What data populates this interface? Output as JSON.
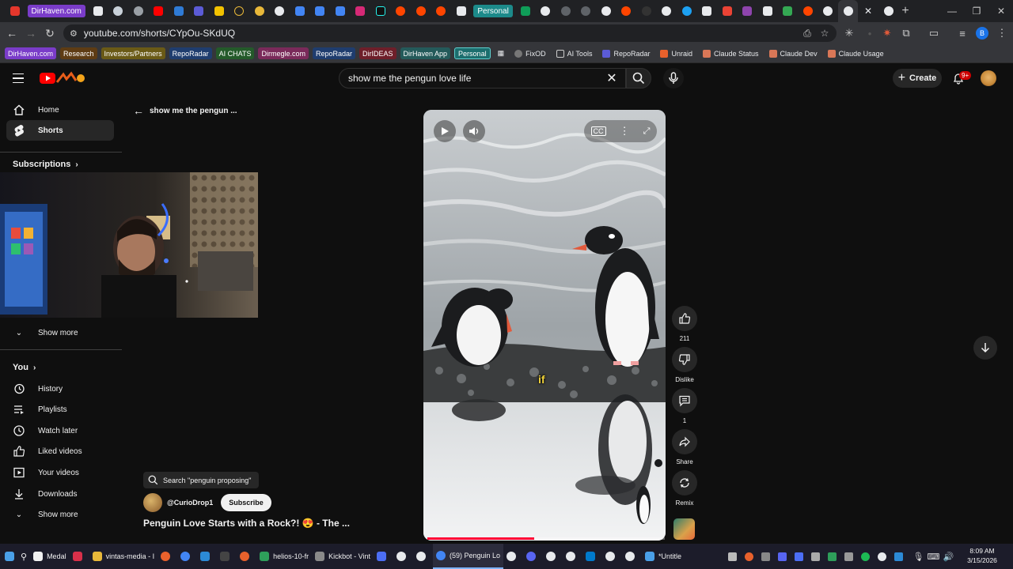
{
  "browser": {
    "tab_pills": {
      "first": "DirHaven.com",
      "personal": "Personal"
    },
    "url": "youtube.com/shorts/CYpOu-SKdUQ",
    "profile_initial": "B"
  },
  "bookmarks": [
    {
      "label": "DirHaven.com",
      "color": "#7a3cc9"
    },
    {
      "label": "Research",
      "color": "#5e3c14"
    },
    {
      "label": "Investors/Partners",
      "color": "#6a5a16"
    },
    {
      "label": "RepoRadar",
      "color": "#1f3d6e"
    },
    {
      "label": "AI CHATS",
      "color": "#245a2a"
    },
    {
      "label": "Dirmegle.com",
      "color": "#7a2a5a"
    },
    {
      "label": "RepoRadar",
      "color": "#1f3d6e"
    },
    {
      "label": "DirIDEAS",
      "color": "#6e1f2a"
    },
    {
      "label": "DirHaven App",
      "color": "#245a5a"
    },
    {
      "label": "Personal",
      "color": "#1c6e6e"
    }
  ],
  "bookmarks_plain": [
    "FixOD",
    "AI Tools",
    "RepoRadar",
    "Unraid",
    "Claude Status",
    "Claude Dev",
    "Claude Usage"
  ],
  "youtube": {
    "search_query": "show me the pengun love life",
    "create_label": "Create",
    "notification_count": "9+"
  },
  "sidebar": {
    "items_top": [
      {
        "label": "Home",
        "icon": "home-icon"
      },
      {
        "label": "Shorts",
        "icon": "shorts-icon"
      }
    ],
    "subscriptions_heading": "Subscriptions",
    "show_more_1": "Show more",
    "you_heading": "You",
    "you_items": [
      {
        "label": "History",
        "icon": "history-icon"
      },
      {
        "label": "Playlists",
        "icon": "playlists-icon"
      },
      {
        "label": "Watch later",
        "icon": "watch-later-icon"
      },
      {
        "label": "Liked videos",
        "icon": "liked-videos-icon"
      },
      {
        "label": "Your videos",
        "icon": "your-videos-icon"
      },
      {
        "label": "Downloads",
        "icon": "downloads-icon"
      }
    ],
    "show_more_2": "Show more"
  },
  "shorts": {
    "back_title": "show me the pengun ...",
    "subtitle_word": "if",
    "progress": 0.45,
    "like_count": "211",
    "dislike_label": "Dislike",
    "comment_count": "1",
    "share_label": "Share",
    "remix_label": "Remix",
    "search_chip": "Search \"penguin proposing\"",
    "channel": "@CurioDrop1",
    "subscribe_label": "Subscribe",
    "title": "Penguin Love Starts with a Rock?! 😍 - The ..."
  },
  "taskbar": {
    "apps": [
      {
        "label": "Medal",
        "color": "#f1f1f1"
      },
      {
        "label": "",
        "color": "#d9304a"
      },
      {
        "label": "vintas-media - I",
        "color": "#e8b83a"
      },
      {
        "label": "helios-10-fr",
        "color": "#2e9e5a"
      },
      {
        "label": "Kickbot - Vint",
        "color": "#8a8a8a"
      },
      {
        "label": "(59) Penguin Lo",
        "color": "#4285f4"
      },
      {
        "label": "*Untitle",
        "color": "#4aa0e8"
      }
    ],
    "time": "8:09 AM",
    "date": "3/15/2026"
  },
  "colors": {
    "accent_red": "#ff0033",
    "bg": "#0f0f0f"
  }
}
